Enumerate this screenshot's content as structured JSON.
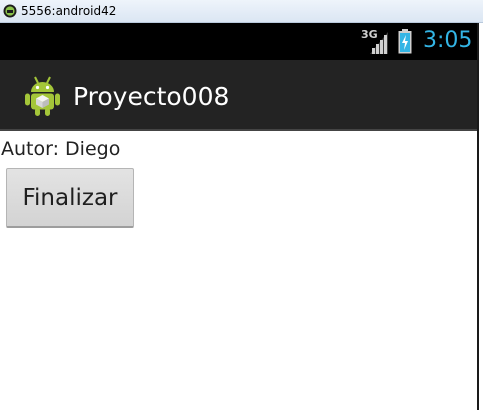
{
  "window": {
    "title": "5556:android42",
    "icon": "android-emulator-icon"
  },
  "status_bar": {
    "network_type": "3G",
    "signal_icon": "signal-bars-icon",
    "battery_icon": "battery-charging-icon",
    "time": "3:05",
    "clock_color": "#33b5e5"
  },
  "action_bar": {
    "app_icon": "android-robot-icon",
    "title": "Proyecto008"
  },
  "content": {
    "author_label": "Autor: Diego",
    "finish_button_label": "Finalizar"
  }
}
